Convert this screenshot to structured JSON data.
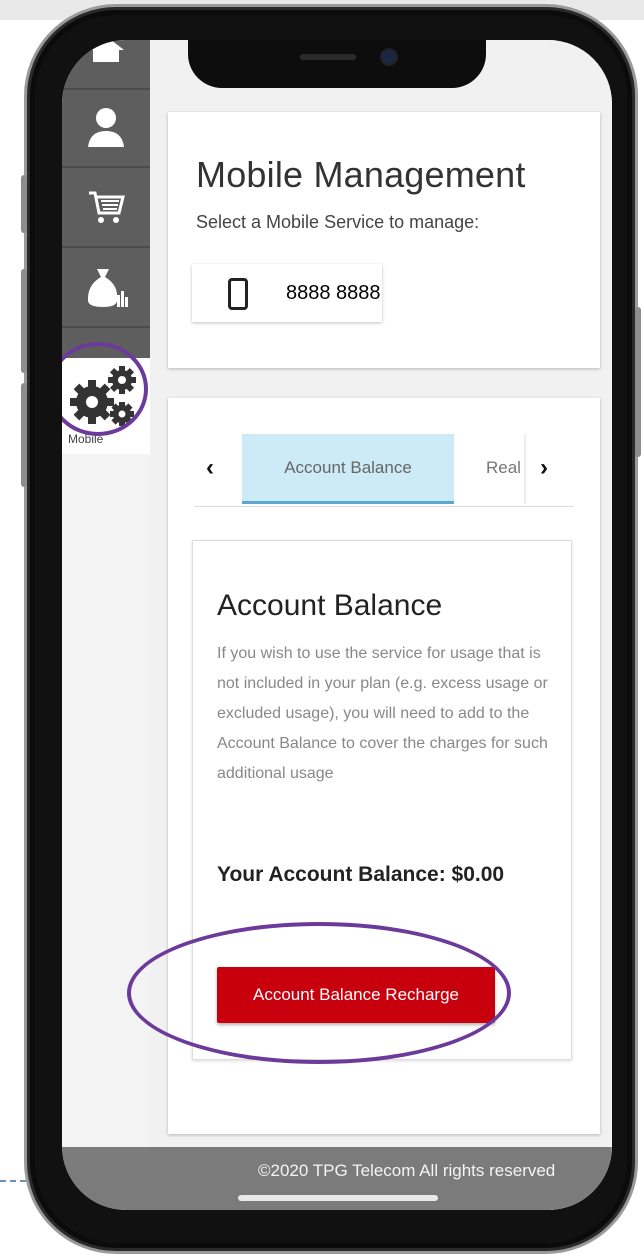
{
  "sidebar": {
    "items": [
      {
        "name": "home",
        "icon": "home-icon"
      },
      {
        "name": "account",
        "icon": "user-icon"
      },
      {
        "name": "shop",
        "icon": "cart-icon"
      },
      {
        "name": "billing",
        "icon": "money-bag-icon"
      },
      {
        "name": "mobile",
        "icon": "gears-icon",
        "label": "Mobile",
        "active": true
      }
    ]
  },
  "header": {
    "title": "Mobile Management",
    "subtitle": "Select a Mobile Service to manage:"
  },
  "service": {
    "number": "8888 8888",
    "icon": "mobile-phone-icon"
  },
  "tabs": {
    "prev_arrow": "‹",
    "next_arrow": "›",
    "items": [
      {
        "label": "Account Balance",
        "active": true
      },
      {
        "label": "Real",
        "active": false
      }
    ]
  },
  "account_balance": {
    "title": "Account Balance",
    "description": "If you wish to use the service for usage that is not included in your plan (e.g. excess usage or excluded usage), you will need to add to the Account Balance to cover the charges for such additional usage",
    "balance_text": "Your Account Balance: $0.00",
    "recharge_label": "Account Balance Recharge"
  },
  "footer": {
    "copyright": "©2020 TPG Telecom All rights reserved"
  },
  "colors": {
    "accent_red": "#c8000d",
    "tab_active_bg": "#cdeaf7",
    "highlight_circle": "#6b3a9a",
    "sidebar_bg": "#5e5e5e"
  }
}
